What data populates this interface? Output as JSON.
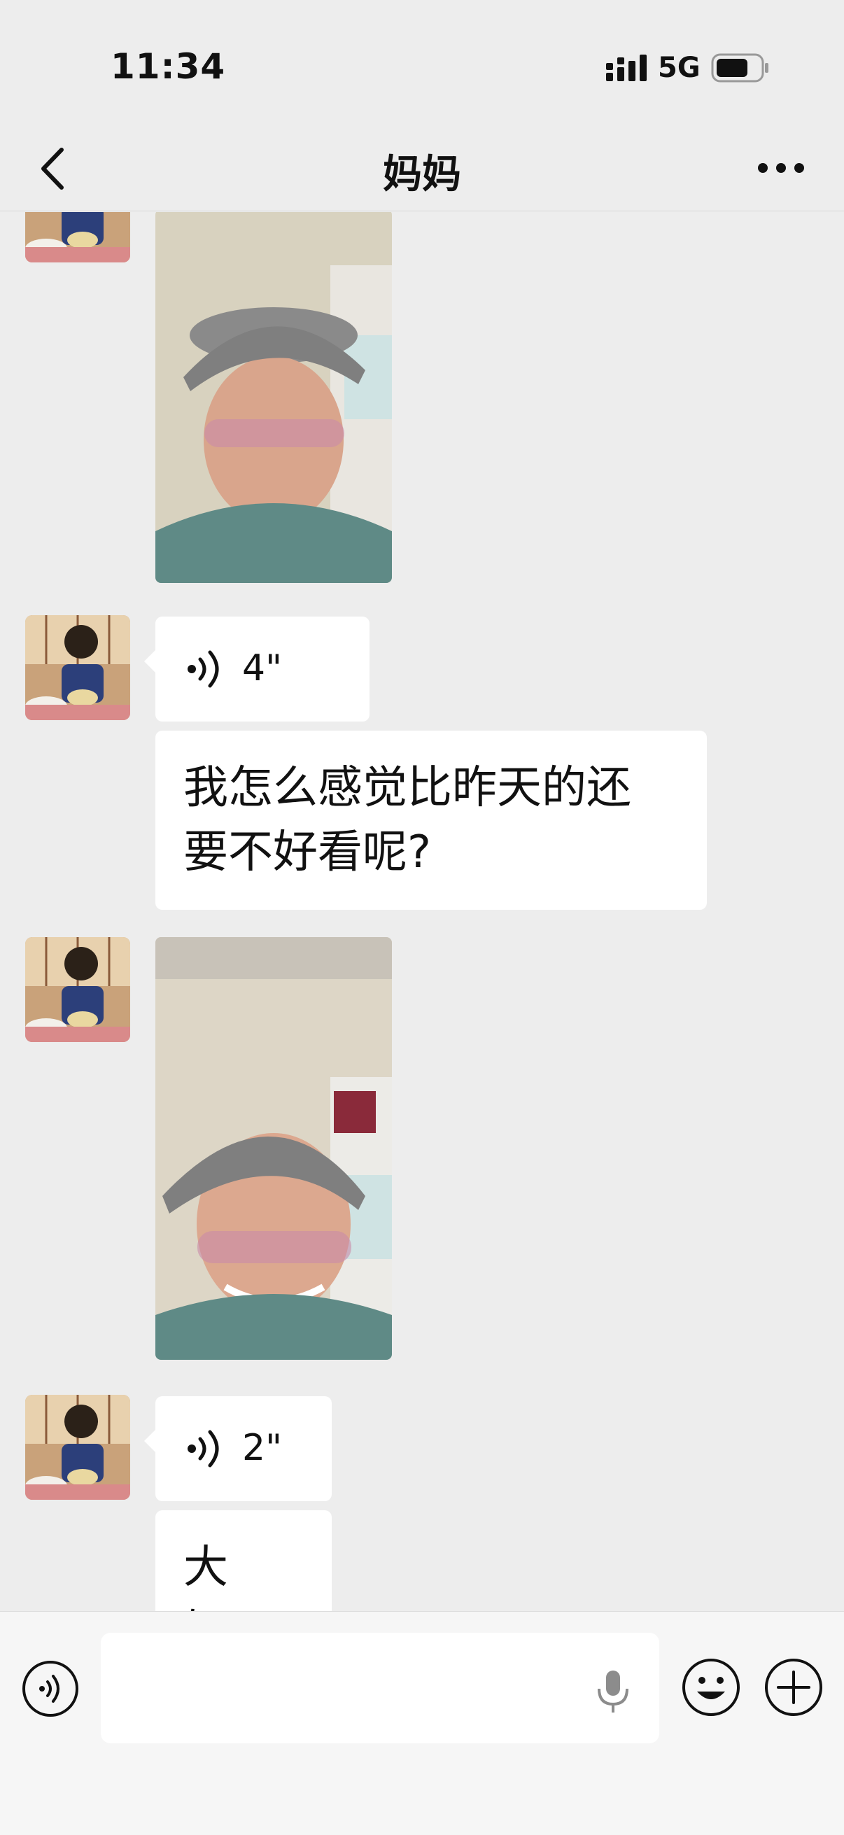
{
  "status_bar": {
    "time": "11:34",
    "network": "5G",
    "signal_icon": "signal-bars-icon",
    "battery_icon": "battery-icon"
  },
  "nav": {
    "title": "妈妈",
    "back_icon": "chevron-left-icon",
    "more_icon": "more-dots-icon"
  },
  "messages": [
    {
      "type": "image",
      "sender": "other",
      "content": "photo of smiling woman wearing gray visor and pink glasses"
    },
    {
      "type": "voice",
      "sender": "other",
      "duration": "4\""
    },
    {
      "type": "text",
      "sender": "other",
      "lines": [
        "我怎么感觉比昨天的还",
        "要不好看呢?"
      ]
    },
    {
      "type": "image",
      "sender": "other",
      "content": "photo of smiling woman wearing gray visor and pink glasses"
    },
    {
      "type": "voice",
      "sender": "other",
      "duration": "2\""
    },
    {
      "type": "text",
      "sender": "other",
      "lines": [
        "大姐。"
      ]
    }
  ],
  "input_bar": {
    "input_value": "",
    "voice_toggle_icon": "voice-toggle-icon",
    "mic_icon": "microphone-icon",
    "emoji_icon": "emoji-icon",
    "plus_icon": "plus-circle-icon"
  },
  "colors": {
    "background": "#ededed",
    "bubble": "#ffffff",
    "text": "#111111"
  }
}
